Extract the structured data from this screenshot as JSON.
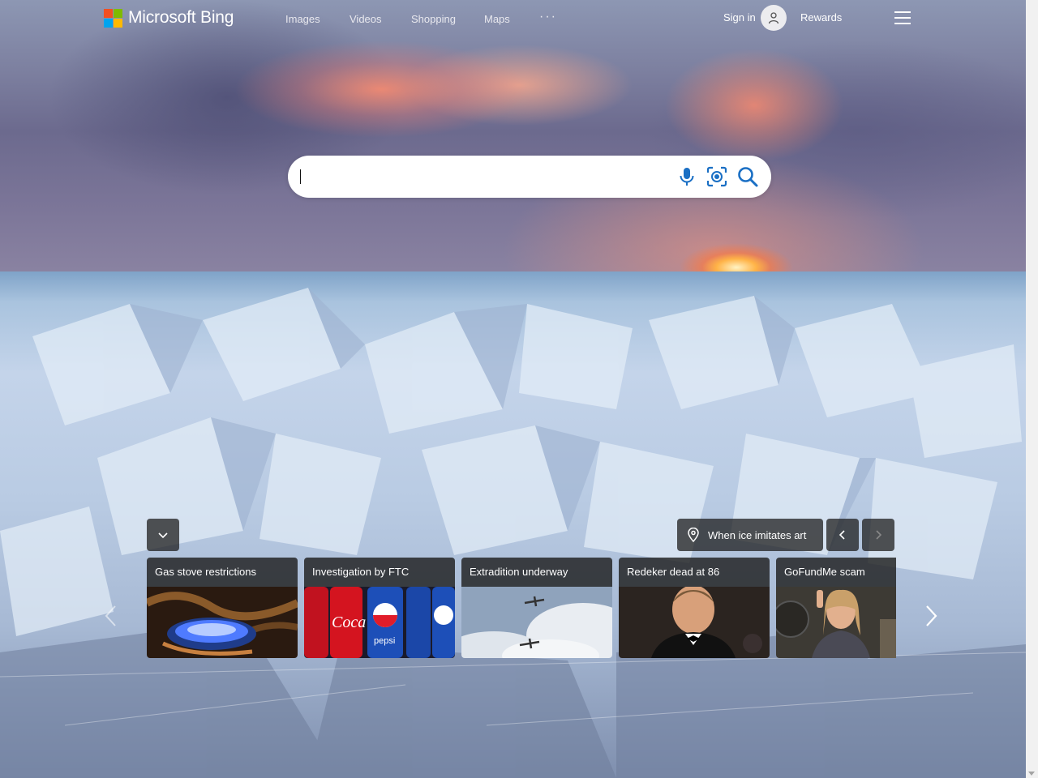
{
  "header": {
    "logo_text": "Microsoft Bing",
    "nav": [
      {
        "label": "Images"
      },
      {
        "label": "Videos"
      },
      {
        "label": "Shopping"
      },
      {
        "label": "Maps"
      }
    ],
    "more_label": "···",
    "sign_in": "Sign in",
    "rewards": "Rewards"
  },
  "search": {
    "value": "",
    "placeholder": ""
  },
  "image_of_day": {
    "caption": "When ice imitates art"
  },
  "news": [
    {
      "title": "Gas stove restrictions"
    },
    {
      "title": "Investigation by FTC"
    },
    {
      "title": "Extradition underway"
    },
    {
      "title": "Redeker dead at 86"
    },
    {
      "title": "GoFundMe scam"
    }
  ],
  "colors": {
    "ms_red": "#f25022",
    "ms_green": "#7fba00",
    "ms_blue": "#00a4ef",
    "ms_yellow": "#ffb900",
    "search_icon": "#1a6fc4"
  },
  "icons": [
    "microphone-icon",
    "visual-search-icon",
    "search-icon",
    "chevron-down-icon",
    "location-pin-icon",
    "chevron-left-icon",
    "chevron-right-icon",
    "hamburger-icon",
    "user-icon"
  ]
}
